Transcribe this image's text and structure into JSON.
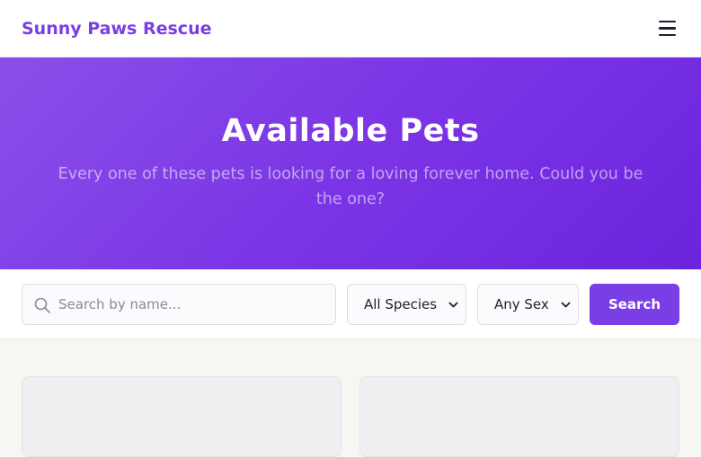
{
  "header": {
    "brand": "Sunny Paws Rescue",
    "menu_icon": "hamburger-menu-icon"
  },
  "hero": {
    "title": "Available Pets",
    "subtitle": "Every one of these pets is looking for a loving forever home. Could you be the one?"
  },
  "filters": {
    "search_placeholder": "Search by name...",
    "search_value": "",
    "species_selected": "All Species",
    "sex_selected": "Any Sex",
    "search_button": "Search"
  },
  "colors": {
    "brand": "#7a3ee6",
    "hero_gradient_start": "#8b4fe8",
    "hero_gradient_end": "#6c24dc",
    "page_background": "#f7f6f3"
  },
  "cards": [
    {
      "state": "loading-placeholder"
    },
    {
      "state": "loading-placeholder"
    }
  ]
}
